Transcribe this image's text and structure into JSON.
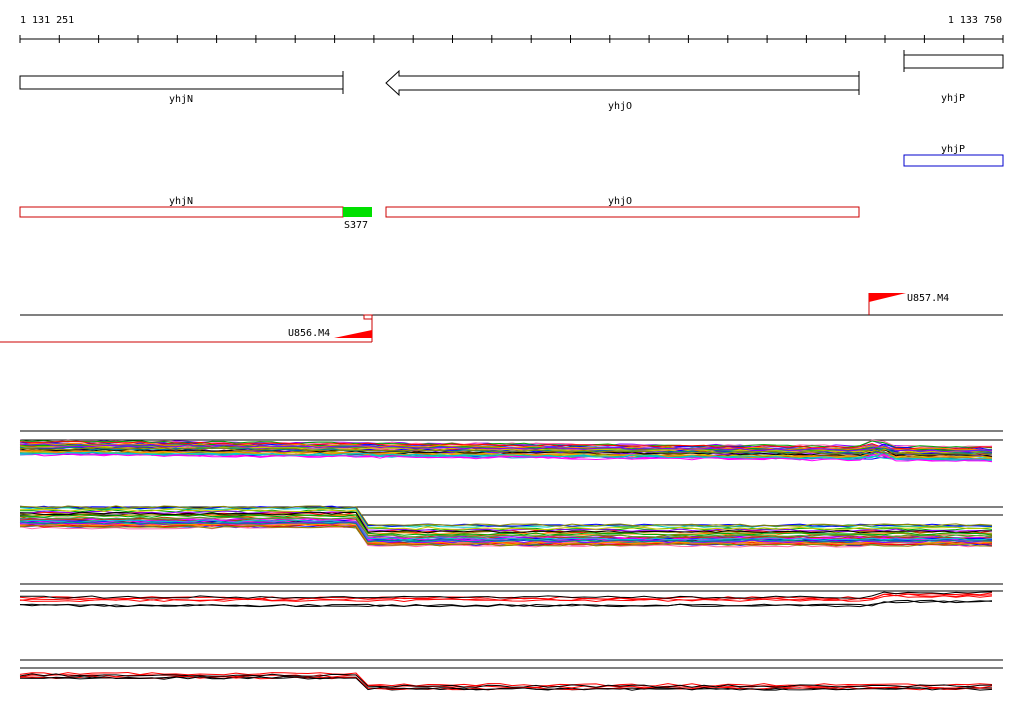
{
  "coordinates": {
    "start_label": "1 131 251",
    "end_label": "1 133 750"
  },
  "annotated_genes": [
    {
      "label": "yhjN",
      "strand": "+"
    },
    {
      "label": "yhjO",
      "strand": "-"
    },
    {
      "label": "yhjP",
      "strand": "+"
    }
  ],
  "blue_genes": [
    {
      "label": "yhjP"
    }
  ],
  "red_genes": [
    {
      "label": "yhjN"
    },
    {
      "label": "yhjO"
    }
  ],
  "segments": [
    {
      "label": "S377",
      "color": "#00e000"
    }
  ],
  "transcription_units": [
    {
      "label": "U857.M4",
      "strand": "+"
    },
    {
      "label": "U856.M4",
      "strand": "-"
    }
  ],
  "expression_panels": [
    {
      "style": "multicolor"
    },
    {
      "style": "multicolor"
    },
    {
      "style": "red-black"
    },
    {
      "style": "red-black"
    }
  ],
  "colors": {
    "gene_outline": "#000000",
    "gene_blue": "#0000cc",
    "gene_red": "#cc0000",
    "segment_green": "#00e000",
    "tu_red": "#ff0000",
    "expr_red": "#ff0000",
    "expr_black": "#000000"
  }
}
